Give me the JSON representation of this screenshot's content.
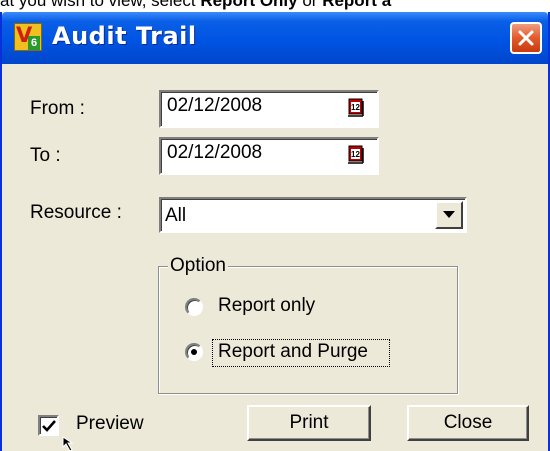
{
  "doc_strip": {
    "prefix": "at you wish to view, select ",
    "opt1": "Report Only",
    "mid": " or ",
    "opt2": "Report a"
  },
  "dialog": {
    "title": "Audit Trail",
    "from_label": "From :",
    "from_value": "02/12/2008",
    "to_label": "To :",
    "to_value": "02/12/2008",
    "resource_label": "Resource :",
    "resource_value": "All",
    "option_group_label": "Option",
    "option_report_only": "Report only",
    "option_report_purge": "Report and Purge",
    "selected_option": "Report and Purge",
    "preview_label": "Preview",
    "preview_checked": true,
    "print_label": "Print",
    "close_label": "Close"
  },
  "icons": {
    "app": "app-logo-icon",
    "close": "close-icon",
    "calendar": "calendar-icon",
    "dropdown": "chevron-down-icon",
    "check": "checkmark-icon",
    "cursor": "mouse-pointer-icon"
  },
  "colors": {
    "titlebar": "#0054e3",
    "close_button": "#e35a2b",
    "dialog_bg": "#ece9d8"
  }
}
